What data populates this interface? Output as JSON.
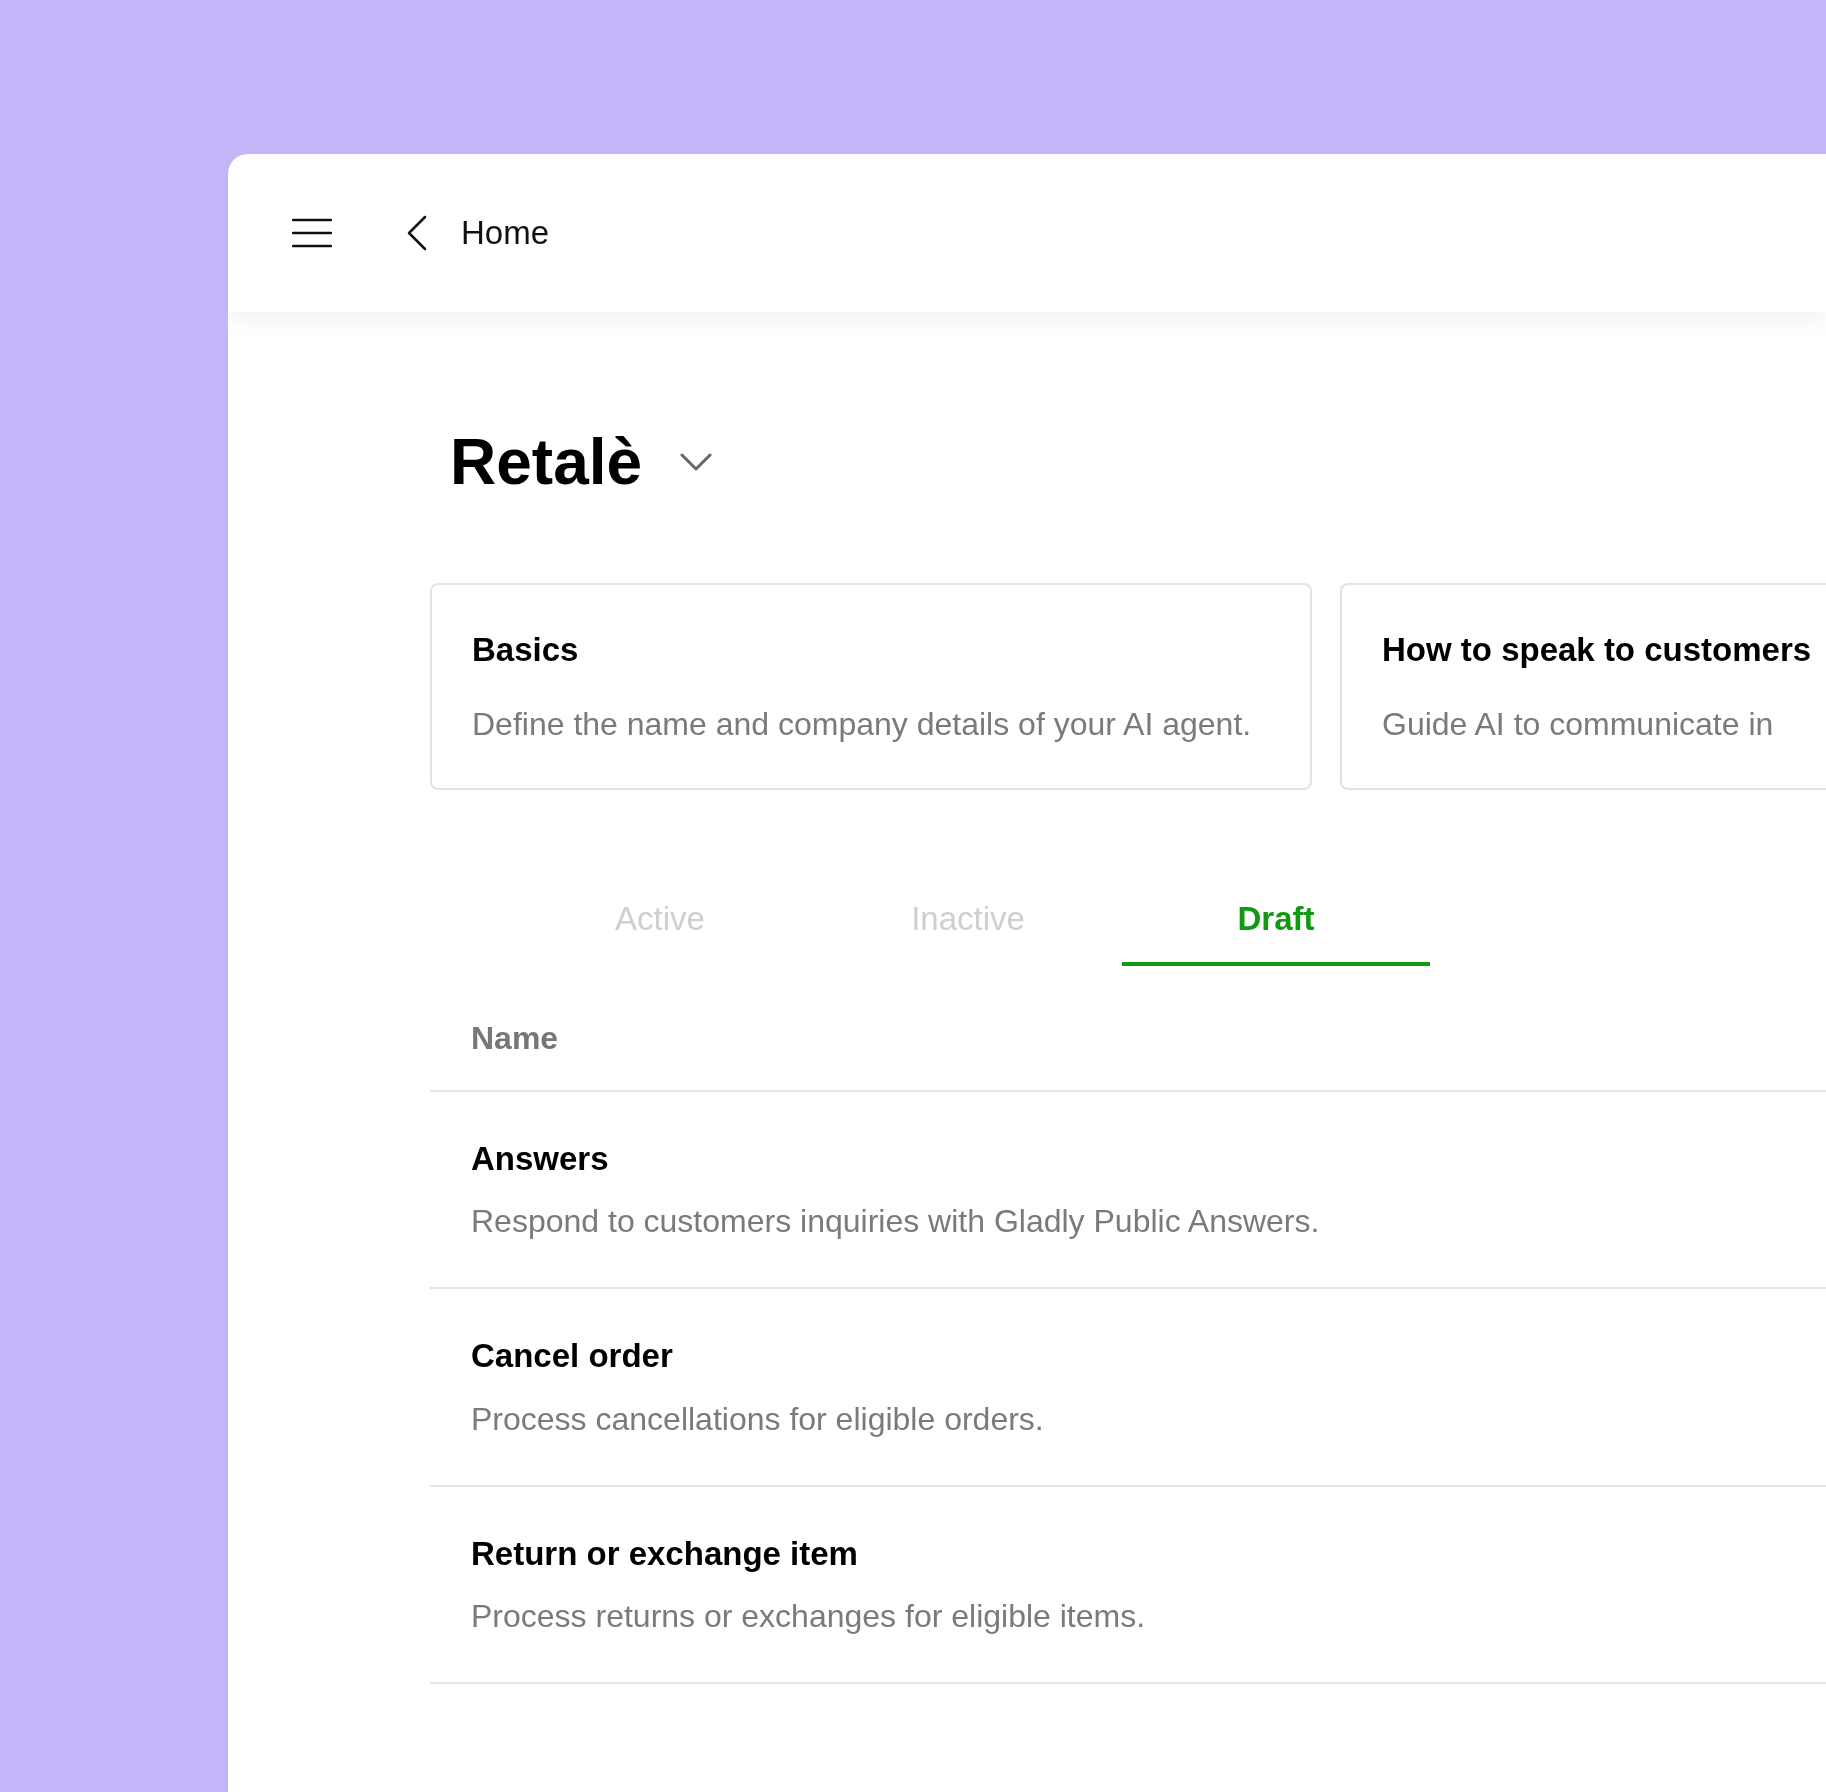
{
  "topbar": {
    "back_label": "Home"
  },
  "agent": {
    "title": "Retalè"
  },
  "cards": [
    {
      "title": "Basics",
      "description": "Define the name and company details of your AI agent."
    },
    {
      "title": "How to speak to customers",
      "description": "Guide AI to communicate in"
    }
  ],
  "tabs": [
    {
      "label": "Active",
      "selected": false
    },
    {
      "label": "Inactive",
      "selected": false
    },
    {
      "label": "Draft",
      "selected": true
    }
  ],
  "table": {
    "columns": [
      "Name"
    ],
    "rows": [
      {
        "name": "Answers",
        "description": "Respond to customers inquiries with Gladly Public Answers."
      },
      {
        "name": "Cancel order",
        "description": "Process cancellations for eligible orders."
      },
      {
        "name": "Return or exchange item",
        "description": "Process returns or exchanges for eligible items."
      }
    ]
  }
}
